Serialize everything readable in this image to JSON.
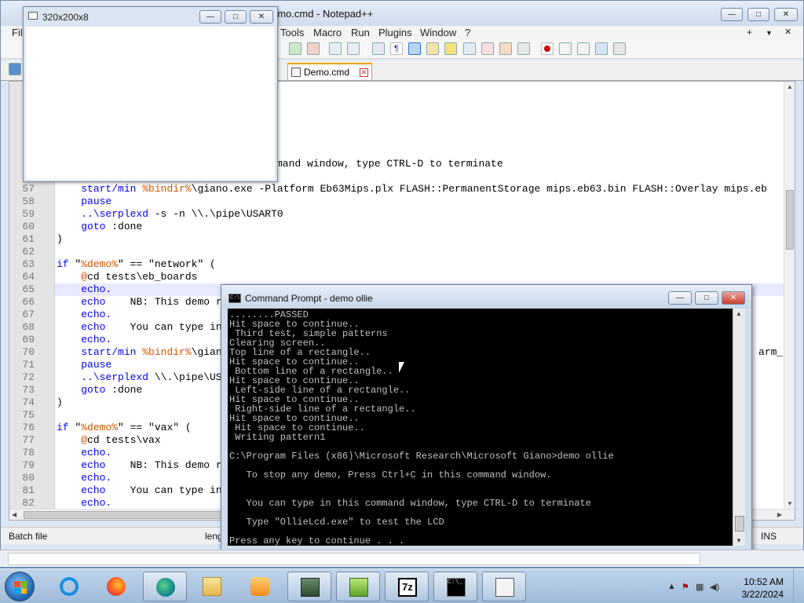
{
  "notepad": {
    "title": "emo.cmd - Notepad++",
    "title_controls": {
      "minimize": "—",
      "maximize": "□",
      "close": "✕"
    },
    "menu": [
      "Fil",
      "Tools",
      "Macro",
      "Run",
      "Plugins",
      "Window",
      "?"
    ],
    "menu_right": {
      "plus": "+",
      "down": "▼",
      "close": "✕"
    },
    "tab": {
      "label": "Demo.cmd",
      "close": "✕"
    },
    "status": {
      "file_type": "Batch file",
      "length_partial": "leng",
      "mode": "INS"
    }
  },
  "editor": {
    "partial_top_line": "mand window, type CTRL-D to terminate",
    "lines": [
      {
        "n": "57",
        "parts": [
          [
            "    ",
            "punc"
          ],
          [
            "start/min ",
            "kw"
          ],
          [
            "%bindir%",
            "var"
          ],
          [
            "\\giano.exe -Platform Eb63Mips.plx FLASH::PermanentStorage mips.eb63.bin FLASH::Overlay mips.eb",
            "punc"
          ]
        ]
      },
      {
        "n": "58",
        "parts": [
          [
            "    ",
            "punc"
          ],
          [
            "pause",
            "kw"
          ]
        ]
      },
      {
        "n": "59",
        "parts": [
          [
            "    ",
            "punc"
          ],
          [
            "..\\serplexd",
            "kw"
          ],
          [
            " -s -n \\\\.\\pipe\\USART0",
            "punc"
          ]
        ]
      },
      {
        "n": "60",
        "parts": [
          [
            "    ",
            "punc"
          ],
          [
            "goto",
            "kw"
          ],
          [
            " :done",
            "punc"
          ]
        ]
      },
      {
        "n": "61",
        "parts": [
          [
            ")",
            "punc"
          ]
        ]
      },
      {
        "n": "62",
        "parts": [
          [
            "",
            "punc"
          ]
        ]
      },
      {
        "n": "63",
        "parts": [
          [
            "if ",
            "kw"
          ],
          [
            "\"",
            "punc"
          ],
          [
            "%demo%",
            "var"
          ],
          [
            "\" == \"network\" (",
            "punc"
          ]
        ]
      },
      {
        "n": "64",
        "parts": [
          [
            "    ",
            "punc"
          ],
          [
            "@",
            "var"
          ],
          [
            "cd tests\\eb_boards",
            "punc"
          ]
        ]
      },
      {
        "n": "65",
        "parts": [
          [
            "    ",
            "punc"
          ],
          [
            "echo.",
            "kw"
          ]
        ]
      },
      {
        "n": "66",
        "parts": [
          [
            "    ",
            "punc"
          ],
          [
            "echo",
            "kw"
          ],
          [
            "    NB: This demo r",
            "punc"
          ]
        ]
      },
      {
        "n": "67",
        "parts": [
          [
            "    ",
            "punc"
          ],
          [
            "echo.",
            "kw"
          ]
        ]
      },
      {
        "n": "68",
        "parts": [
          [
            "    ",
            "punc"
          ],
          [
            "echo",
            "kw"
          ],
          [
            "    You can type in",
            "punc"
          ]
        ]
      },
      {
        "n": "69",
        "parts": [
          [
            "    ",
            "punc"
          ],
          [
            "echo.",
            "kw"
          ]
        ]
      },
      {
        "n": "70",
        "parts": [
          [
            "    ",
            "punc"
          ],
          [
            "start/min ",
            "kw"
          ],
          [
            "%bindir%",
            "var"
          ],
          [
            "\\gian",
            "punc"
          ]
        ]
      },
      {
        "n": "71",
        "parts": [
          [
            "    ",
            "punc"
          ],
          [
            "pause",
            "kw"
          ]
        ]
      },
      {
        "n": "72",
        "parts": [
          [
            "    ",
            "punc"
          ],
          [
            "..\\serplexd",
            "kw"
          ],
          [
            " \\\\.\\pipe\\US",
            "punc"
          ]
        ]
      },
      {
        "n": "73",
        "parts": [
          [
            "    ",
            "punc"
          ],
          [
            "goto",
            "kw"
          ],
          [
            " :done",
            "punc"
          ]
        ]
      },
      {
        "n": "74",
        "parts": [
          [
            ")",
            "punc"
          ]
        ]
      },
      {
        "n": "75",
        "parts": [
          [
            "",
            "punc"
          ]
        ]
      },
      {
        "n": "76",
        "parts": [
          [
            "if ",
            "kw"
          ],
          [
            "\"",
            "punc"
          ],
          [
            "%demo%",
            "var"
          ],
          [
            "\" == \"vax\" (",
            "punc"
          ]
        ]
      },
      {
        "n": "77",
        "parts": [
          [
            "    ",
            "punc"
          ],
          [
            "@",
            "var"
          ],
          [
            "cd tests\\vax",
            "punc"
          ]
        ]
      },
      {
        "n": "78",
        "parts": [
          [
            "    ",
            "punc"
          ],
          [
            "echo.",
            "kw"
          ]
        ]
      },
      {
        "n": "79",
        "parts": [
          [
            "    ",
            "punc"
          ],
          [
            "echo",
            "kw"
          ],
          [
            "    NB: This demo r",
            "punc"
          ]
        ]
      },
      {
        "n": "80",
        "parts": [
          [
            "    ",
            "punc"
          ],
          [
            "echo.",
            "kw"
          ]
        ]
      },
      {
        "n": "81",
        "parts": [
          [
            "    ",
            "punc"
          ],
          [
            "echo",
            "kw"
          ],
          [
            "    You can type in",
            "punc"
          ]
        ]
      },
      {
        "n": "82",
        "parts": [
          [
            "    ",
            "punc"
          ],
          [
            "echo.",
            "kw"
          ]
        ]
      }
    ],
    "overflow_right": "arm_g"
  },
  "win320": {
    "title": "320x200x8"
  },
  "cmd": {
    "title": "Command Prompt - demo  ollie",
    "lines": [
      "........PASSED",
      "Hit space to continue..",
      " Third test, simple patterns",
      "Clearing screen..",
      "Top line of a rectangle..",
      "Hit space to continue..",
      " Bottom line of a rectangle..",
      "Hit space to continue..",
      " Left-side line of a rectangle..",
      "Hit space to continue..",
      " Right-side line of a rectangle..",
      "Hit space to continue..",
      " Hit space to continue..",
      " Writing pattern1",
      "",
      "C:\\Program Files (x86)\\Microsoft Research\\Microsoft Giano>demo ollie",
      "",
      "   To stop any demo, Press Ctrl+C in this command window.",
      "",
      "",
      "   You can type in this command window, type CTRL-D to terminate",
      "",
      "   Type \"OllieLcd.exe\" to test the LCD",
      "",
      "Press any key to continue . . ."
    ]
  },
  "taskbar": {
    "clock_time": "10:52 AM",
    "clock_date": "3/22/2024",
    "apps": [
      "internet-explorer",
      "firefox",
      "edge",
      "file-explorer",
      "media-player",
      "vm-console",
      "notepad-plus-plus",
      "7zip",
      "command-prompt",
      "document-viewer"
    ]
  },
  "colors": {
    "accent_tab": "#f6a000",
    "keyword": "#0000ff",
    "variable": "#d45500",
    "console_bg": "#000000",
    "console_fg": "#c0c0c0"
  }
}
